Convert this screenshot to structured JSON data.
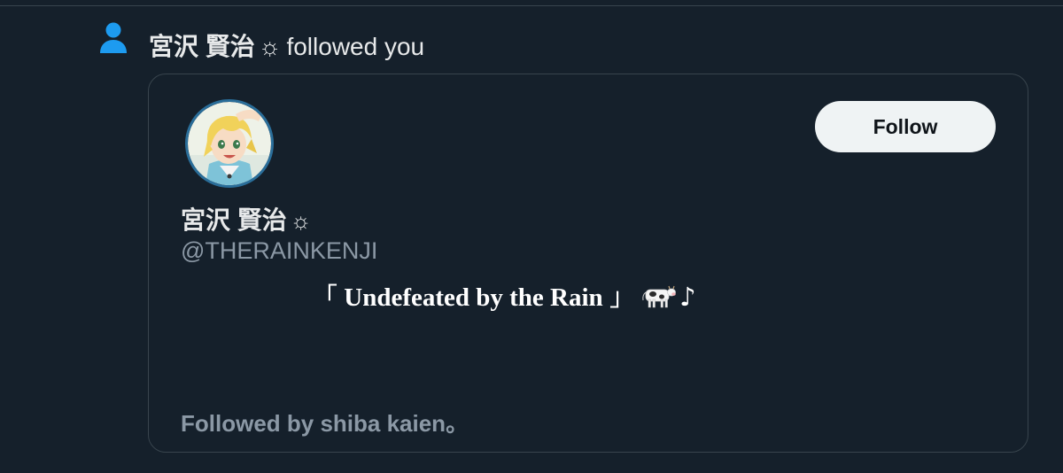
{
  "notification": {
    "icon": "person-icon",
    "actor_name": "宮沢 賢治",
    "actor_badge": "☼",
    "action_text": "followed you"
  },
  "card": {
    "follow_button_label": "Follow",
    "display_name": "宮沢 賢治",
    "display_name_badge": "☼",
    "handle": "@THERAINKENJI",
    "bio": {
      "open_bracket": "「",
      "text": "Undefeated by the Rain",
      "close_bracket": "」",
      "emoji_icon": "cow-icon",
      "note": "♪"
    },
    "followed_by": "Followed by shiba kaien。"
  },
  "colors": {
    "background": "#15202b",
    "border": "#38444d",
    "primary_text": "#e7e9ea",
    "secondary_text": "#8b98a5",
    "accent_icon": "#1d9bf0",
    "button_bg": "#eff3f4",
    "button_text": "#0f1419"
  }
}
